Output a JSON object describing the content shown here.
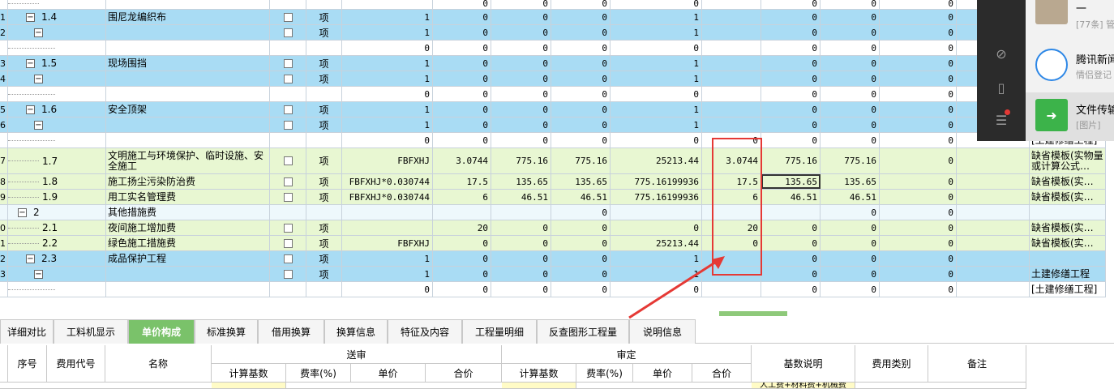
{
  "rows": [
    {
      "rowno": "",
      "level": 1,
      "toggle": "",
      "code": "",
      "name": "",
      "unit": "",
      "check": false,
      "base": "",
      "v1": "0",
      "v2": "0",
      "v3": "0",
      "v4": "0",
      "v5": "",
      "v6": "0",
      "v7": "0",
      "v8": "0",
      "rem": "",
      "bg": "white"
    },
    {
      "rowno": "1",
      "level": 1,
      "toggle": "−",
      "code": "1.4",
      "name": "围尼龙编织布",
      "unit": "项",
      "check": true,
      "base": "1",
      "v1": "0",
      "v2": "0",
      "v3": "0",
      "v4": "1",
      "v5": "",
      "v6": "0",
      "v7": "0",
      "v8": "0",
      "rem": "",
      "bg": "blue"
    },
    {
      "rowno": "2",
      "level": 2,
      "toggle": "−",
      "code": "",
      "name": "",
      "unit": "项",
      "check": true,
      "base": "1",
      "v1": "0",
      "v2": "0",
      "v3": "0",
      "v4": "1",
      "v5": "",
      "v6": "0",
      "v7": "0",
      "v8": "0",
      "rem": "",
      "bg": "blue"
    },
    {
      "rowno": "",
      "level": 3,
      "toggle": "",
      "code": "",
      "name": "",
      "unit": "",
      "check": false,
      "base": "0",
      "v1": "0",
      "v2": "0",
      "v3": "0",
      "v4": "0",
      "v5": "",
      "v6": "0",
      "v7": "0",
      "v8": "0",
      "rem": "",
      "bg": "white"
    },
    {
      "rowno": "3",
      "level": 1,
      "toggle": "−",
      "code": "1.5",
      "name": "现场围挡",
      "unit": "项",
      "check": true,
      "base": "1",
      "v1": "0",
      "v2": "0",
      "v3": "0",
      "v4": "1",
      "v5": "",
      "v6": "0",
      "v7": "0",
      "v8": "0",
      "rem": "",
      "bg": "blue"
    },
    {
      "rowno": "4",
      "level": 2,
      "toggle": "−",
      "code": "",
      "name": "",
      "unit": "项",
      "check": true,
      "base": "1",
      "v1": "0",
      "v2": "0",
      "v3": "0",
      "v4": "1",
      "v5": "",
      "v6": "0",
      "v7": "0",
      "v8": "0",
      "rem": "",
      "bg": "blue"
    },
    {
      "rowno": "",
      "level": 3,
      "toggle": "",
      "code": "",
      "name": "",
      "unit": "",
      "check": false,
      "base": "0",
      "v1": "0",
      "v2": "0",
      "v3": "0",
      "v4": "0",
      "v5": "",
      "v6": "0",
      "v7": "0",
      "v8": "0",
      "rem": "",
      "bg": "white"
    },
    {
      "rowno": "5",
      "level": 1,
      "toggle": "−",
      "code": "1.6",
      "name": "安全顶架",
      "unit": "项",
      "check": true,
      "base": "1",
      "v1": "0",
      "v2": "0",
      "v3": "0",
      "v4": "1",
      "v5": "",
      "v6": "0",
      "v7": "0",
      "v8": "0",
      "rem": "",
      "bg": "blue"
    },
    {
      "rowno": "6",
      "level": 2,
      "toggle": "−",
      "code": "",
      "name": "",
      "unit": "项",
      "check": true,
      "base": "1",
      "v1": "0",
      "v2": "0",
      "v3": "0",
      "v4": "1",
      "v5": "",
      "v6": "0",
      "v7": "0",
      "v8": "0",
      "rem": "",
      "bg": "blue"
    },
    {
      "rowno": "",
      "level": 3,
      "toggle": "",
      "code": "",
      "name": "",
      "unit": "",
      "check": false,
      "base": "0",
      "v1": "0",
      "v2": "0",
      "v3": "0",
      "v4": "0",
      "v5": "0",
      "v6": "0",
      "v7": "0",
      "v8": "0",
      "rem": "[土建修缮工程]",
      "bg": "white"
    },
    {
      "rowno": "7",
      "level": 1,
      "toggle": "",
      "code": "1.7",
      "name": "文明施工与环境保护、临时设施、安全施工",
      "unit": "项",
      "check": true,
      "base": "FBFXHJ",
      "v1": "3.0744",
      "v2": "775.16",
      "v3": "775.16",
      "v4": "25213.44",
      "v5": "3.0744",
      "v6": "775.16",
      "v7": "775.16",
      "v8": "0",
      "rem": "缺省模板(实物量或计算公式…",
      "bg": "green",
      "tall": true
    },
    {
      "rowno": "8",
      "level": 1,
      "toggle": "",
      "code": "1.8",
      "name": "施工扬尘污染防治费",
      "unit": "项",
      "check": true,
      "base": "FBFXHJ*0.030744",
      "v1": "17.5",
      "v2": "135.65",
      "v3": "135.65",
      "v4": "775.16199936",
      "v5": "17.5",
      "v6": "135.65",
      "v7": "135.65",
      "v8": "0",
      "rem": "缺省模板(实…",
      "bg": "green",
      "selected": true
    },
    {
      "rowno": "9",
      "level": 1,
      "toggle": "",
      "code": "1.9",
      "name": "用工实名管理费",
      "unit": "项",
      "check": true,
      "base": "FBFXHJ*0.030744",
      "v1": "6",
      "v2": "46.51",
      "v3": "46.51",
      "v4": "775.16199936",
      "v5": "6",
      "v6": "46.51",
      "v7": "46.51",
      "v8": "0",
      "rem": "缺省模板(实…",
      "bg": "green"
    },
    {
      "rowno": "",
      "level": 0,
      "toggle": "−",
      "code": "2",
      "name": "其他措施费",
      "unit": "",
      "check": false,
      "base": "",
      "v1": "",
      "v2": "",
      "v3": "0",
      "v4": "",
      "v5": "",
      "v6": "",
      "v7": "0",
      "v8": "0",
      "rem": "",
      "bg": "light"
    },
    {
      "rowno": "0",
      "level": 1,
      "toggle": "",
      "code": "2.1",
      "name": "夜间施工增加费",
      "unit": "项",
      "check": true,
      "base": "",
      "v1": "20",
      "v2": "0",
      "v3": "0",
      "v4": "0",
      "v5": "20",
      "v6": "0",
      "v7": "0",
      "v8": "0",
      "rem": "缺省模板(实…",
      "bg": "green"
    },
    {
      "rowno": "1",
      "level": 1,
      "toggle": "",
      "code": "2.2",
      "name": "绿色施工措施费",
      "unit": "项",
      "check": true,
      "base": "FBFXHJ",
      "v1": "0",
      "v2": "0",
      "v3": "0",
      "v4": "25213.44",
      "v5": "0",
      "v6": "0",
      "v7": "0",
      "v8": "0",
      "rem": "缺省模板(实…",
      "bg": "green"
    },
    {
      "rowno": "2",
      "level": 1,
      "toggle": "−",
      "code": "2.3",
      "name": "成品保护工程",
      "unit": "项",
      "check": true,
      "base": "1",
      "v1": "0",
      "v2": "0",
      "v3": "0",
      "v4": "1",
      "v5": "",
      "v6": "0",
      "v7": "0",
      "v8": "0",
      "rem": "",
      "bg": "blue"
    },
    {
      "rowno": "3",
      "level": 2,
      "toggle": "−",
      "code": "",
      "name": "",
      "unit": "项",
      "check": true,
      "base": "1",
      "v1": "0",
      "v2": "0",
      "v3": "0",
      "v4": "1",
      "v5": "",
      "v6": "0",
      "v7": "0",
      "v8": "0",
      "rem": "土建修缮工程",
      "bg": "blue"
    },
    {
      "rowno": "",
      "level": 3,
      "toggle": "",
      "code": "",
      "name": "",
      "unit": "",
      "check": false,
      "base": "0",
      "v1": "0",
      "v2": "0",
      "v3": "0",
      "v4": "0",
      "v5": "",
      "v6": "0",
      "v7": "0",
      "v8": "0",
      "rem": "[土建修缮工程]",
      "bg": "white"
    }
  ],
  "overlay": {
    "items": [
      {
        "title": "一",
        "sub": "[77条] 管"
      },
      {
        "title": "腾讯新闻",
        "sub": "情侣登记"
      },
      {
        "title": "文件传输",
        "sub": "[图片]"
      }
    ]
  },
  "tabs": [
    "详细对比",
    "工料机显示",
    "单价构成",
    "标准换算",
    "借用换算",
    "换算信息",
    "特征及内容",
    "工程量明细",
    "反查图形工程量",
    "说明信息"
  ],
  "bottom": {
    "seq": "序号",
    "code": "费用代号",
    "name": "名称",
    "send_group": "送审",
    "review_group": "审定",
    "calc_base": "计算基数",
    "rate": "费率(%)",
    "unit_price": "单价",
    "total": "合价",
    "base_desc": "基数说明",
    "fee_type": "费用类别",
    "note": "备注",
    "partial_row_desc": "人工费+材料费+机械费"
  },
  "colors": {
    "blue": "#a9dcf4",
    "green": "#e8f7d2",
    "accent": "#7ac26a",
    "annotation": "#e53935"
  }
}
